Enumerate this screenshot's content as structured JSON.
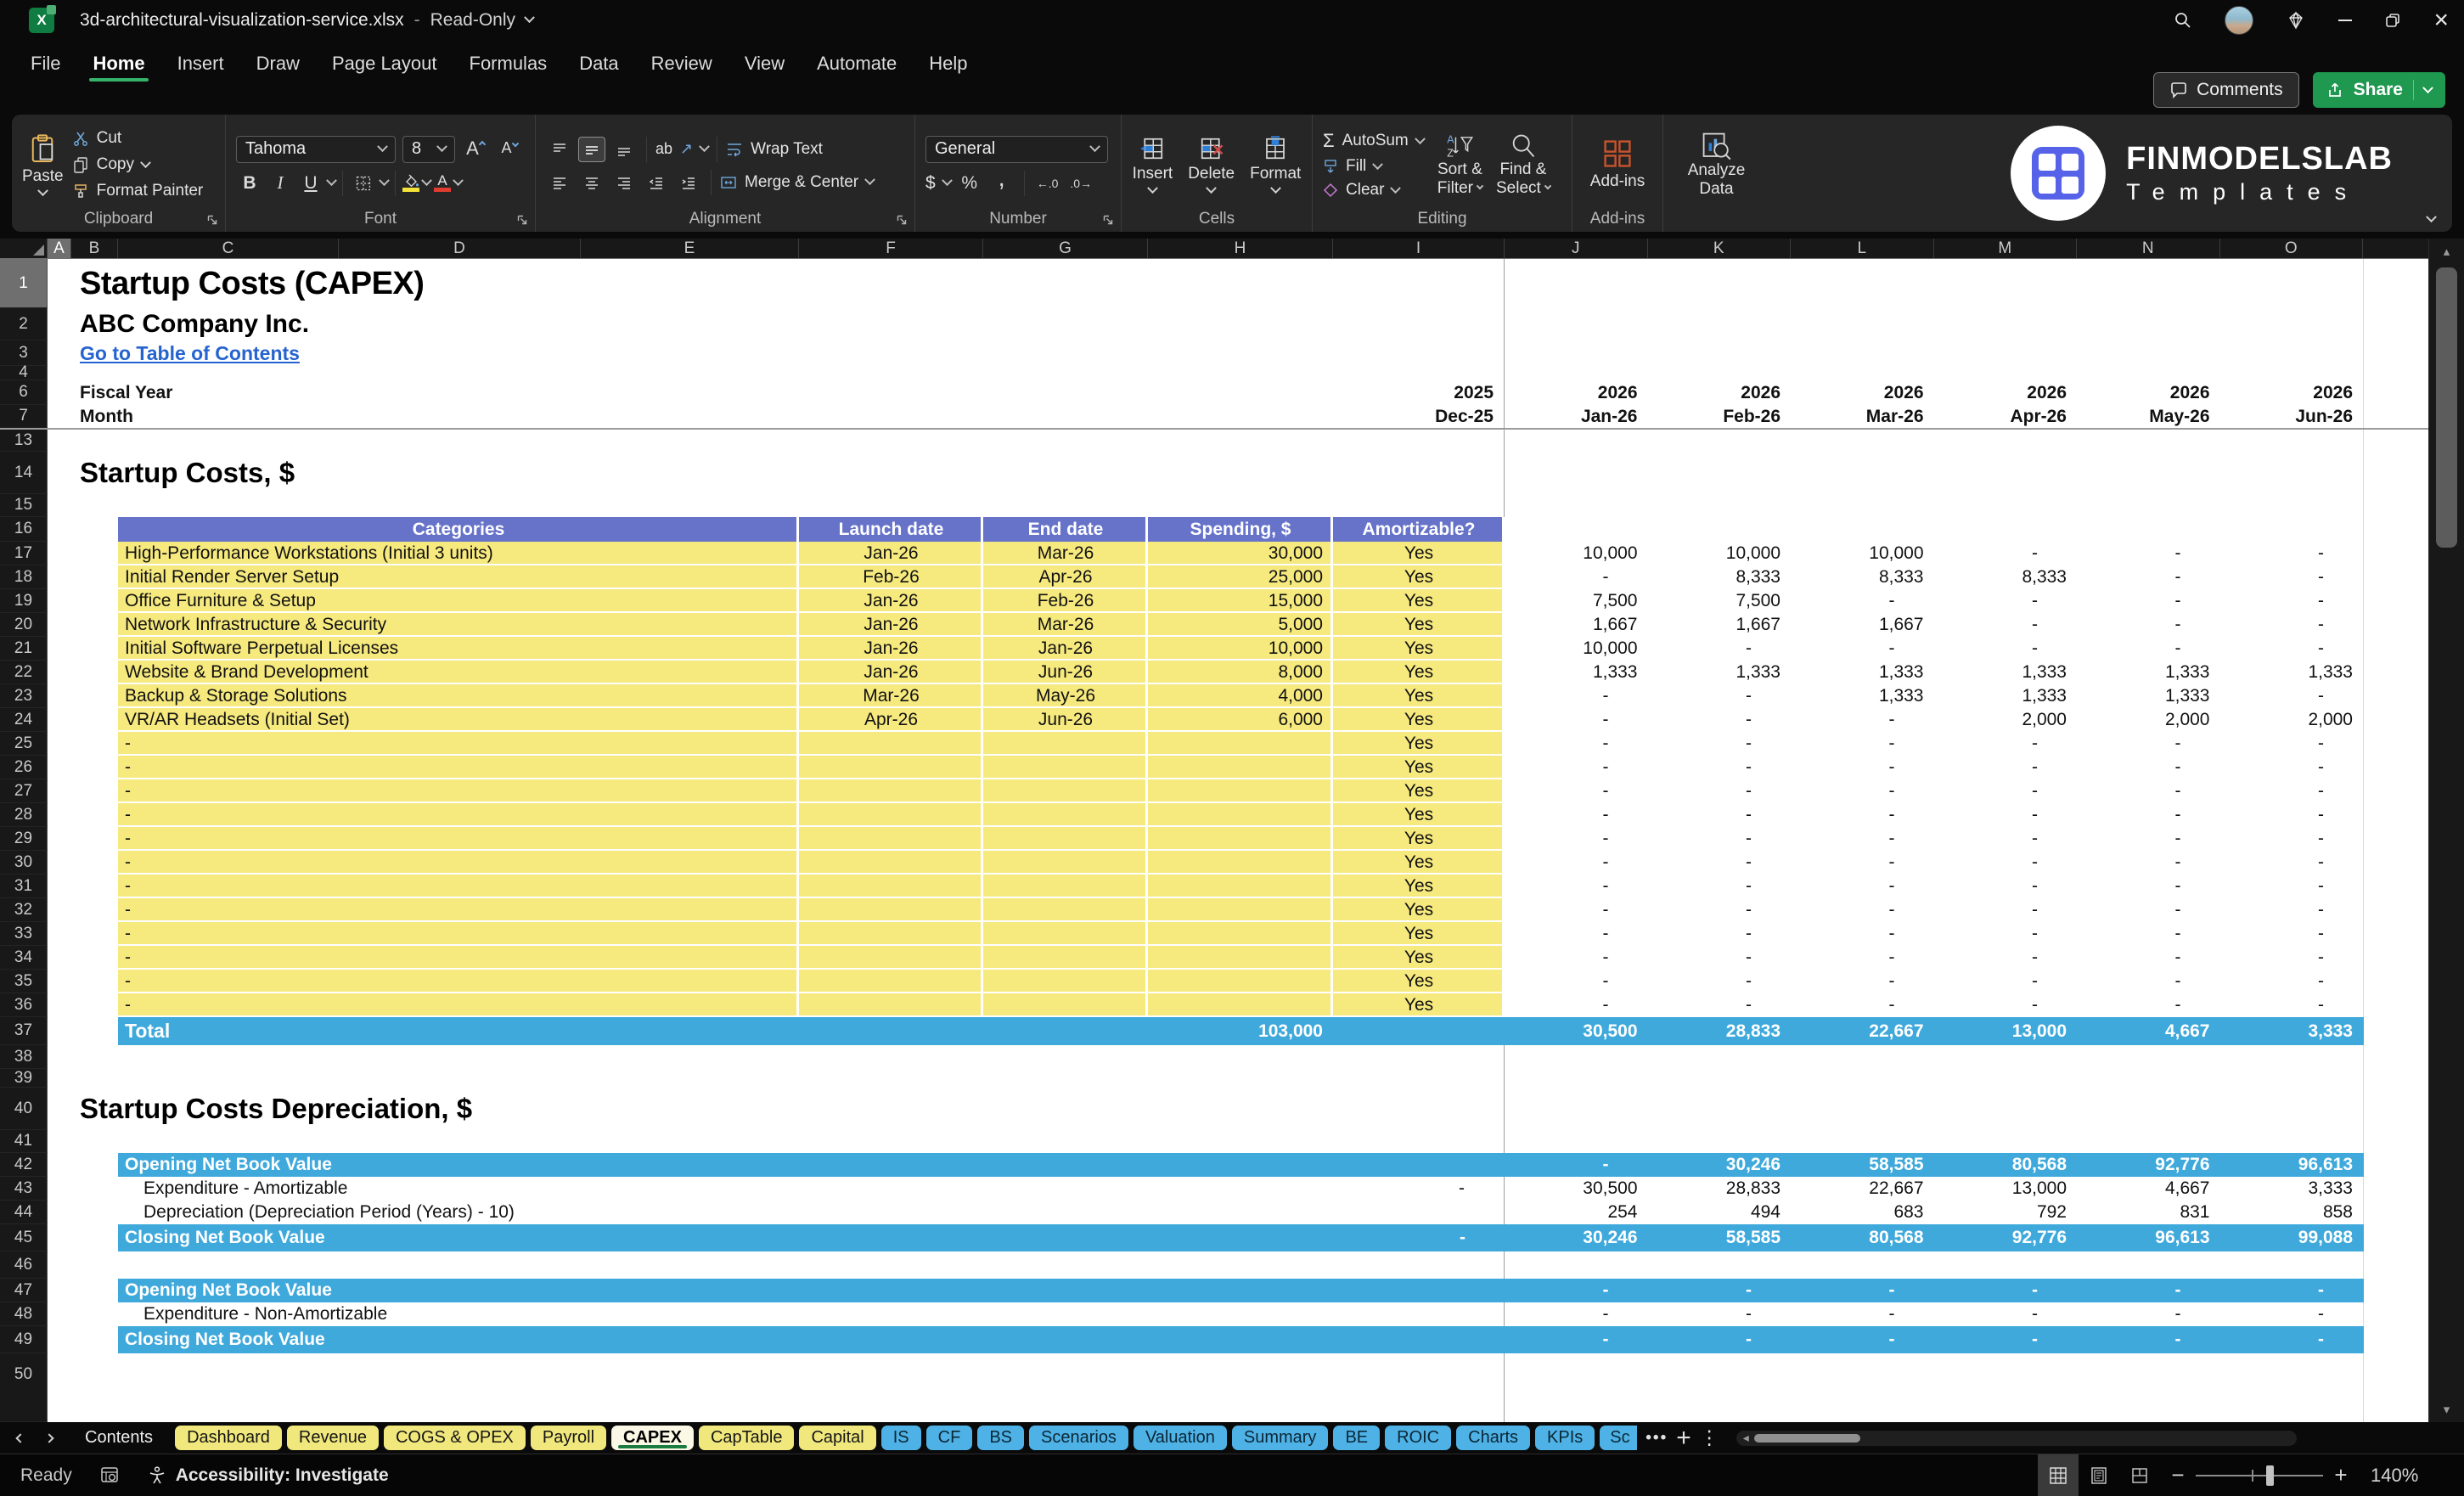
{
  "titlebar": {
    "filename": "3d-architectural-visualization-service.xlsx",
    "separator": "-",
    "mode": "Read-Only"
  },
  "menu": {
    "tabs": [
      {
        "label": "File",
        "cls": ""
      },
      {
        "label": "Home",
        "cls": "active"
      },
      {
        "label": "Insert",
        "cls": ""
      },
      {
        "label": "Draw",
        "cls": ""
      },
      {
        "label": "Page Layout",
        "cls": ""
      },
      {
        "label": "Formulas",
        "cls": ""
      },
      {
        "label": "Data",
        "cls": ""
      },
      {
        "label": "Review",
        "cls": ""
      },
      {
        "label": "View",
        "cls": ""
      },
      {
        "label": "Automate",
        "cls": ""
      },
      {
        "label": "Help",
        "cls": ""
      }
    ],
    "comments_label": "Comments",
    "share_label": "Share"
  },
  "ribbon": {
    "clipboard": {
      "label": "Clipboard",
      "paste": "Paste",
      "cut": "Cut",
      "copy": "Copy",
      "format_painter": "Format Painter"
    },
    "font": {
      "label": "Font",
      "font_name": "Tahoma",
      "font_size": "8",
      "grow": "A",
      "shrink": "A",
      "bold": "B",
      "italic": "I",
      "underline": "U"
    },
    "alignment": {
      "label": "Alignment",
      "orientation": "ab",
      "wrap_text": "Wrap Text",
      "merge_center": "Merge & Center"
    },
    "number": {
      "label": "Number",
      "format": "General",
      "currency": "$",
      "percent": "%",
      "comma": ",",
      "inc_decimal": "←.0",
      "dec_decimal": ".0→"
    },
    "cells": {
      "label": "Cells",
      "insert": "Insert",
      "delete": "Delete",
      "format": "Format"
    },
    "editing": {
      "label": "Editing",
      "sigma": "Σ",
      "autosum": "AutoSum",
      "fill": "Fill",
      "clear": "Clear",
      "sort1": "Sort &",
      "sort2": "Filter",
      "find1": "Find &",
      "find2": "Select"
    },
    "addins": {
      "label": "Add-ins",
      "addins": "Add-ins",
      "analyze1": "Analyze",
      "analyze2": "Data"
    },
    "logo": {
      "title": "FINMODELSLAB",
      "subtitle": "Templates"
    },
    "accent_green": "#35b36b"
  },
  "sheet": {
    "columns": [
      {
        "letter": "A",
        "cls": "wa sel"
      },
      {
        "letter": "B",
        "cls": "wb"
      },
      {
        "letter": "C",
        "cls": "wc"
      },
      {
        "letter": "D",
        "cls": "wd"
      },
      {
        "letter": "E",
        "cls": "we"
      },
      {
        "letter": "F",
        "cls": "wf"
      },
      {
        "letter": "G",
        "cls": "wg"
      },
      {
        "letter": "H",
        "cls": "wh"
      },
      {
        "letter": "I",
        "cls": "wi"
      },
      {
        "letter": "J",
        "cls": "wm"
      },
      {
        "letter": "K",
        "cls": "wm"
      },
      {
        "letter": "L",
        "cls": "wm"
      },
      {
        "letter": "M",
        "cls": "wm"
      },
      {
        "letter": "N",
        "cls": "wm"
      },
      {
        "letter": "O",
        "cls": "wm"
      }
    ],
    "rn": {
      "r1": "1",
      "r2": "2",
      "r3": "3",
      "r4": "4",
      "r6": "6",
      "r7": "7",
      "r13": "13",
      "r14": "14",
      "r15": "15",
      "r16": "16",
      "r37": "37",
      "r38": "38",
      "r39": "39",
      "r40": "40",
      "r41": "41",
      "r46": "46",
      "r50": "50"
    },
    "title": "Startup Costs (CAPEX)",
    "company": "ABC Company Inc.",
    "toc_link": "Go to Table of Contents",
    "fiscal_year_label": "Fi­scal Year",
    "month_label": "Month",
    "fiscal_years": [
      "2025",
      "2026",
      "2026",
      "2026",
      "2026",
      "2026",
      "2026"
    ],
    "months": [
      "Dec-25",
      "Jan-26",
      "Feb-26",
      "Mar-26",
      "Apr-26",
      "May-26",
      "Jun-26"
    ],
    "section1_title": "Startup Costs, $",
    "section2_title": "Startup Costs Depreciation, $",
    "table": {
      "headers": [
        "Categories",
        "Launch date",
        "End date",
        "Spending, $",
        "Amortizable?"
      ],
      "rows": [
        {
          "n": "17",
          "category": "High-Performance Workstations (Initial 3 units)",
          "launch": "Jan-26",
          "end": "Mar-26",
          "spending": "30,000",
          "amort": "Yes",
          "m": [
            "10,000",
            "10,000",
            "10,000",
            "-",
            "-",
            "-"
          ]
        },
        {
          "n": "18",
          "category": "Initial Render Server Setup",
          "launch": "Feb-26",
          "end": "Apr-26",
          "spending": "25,000",
          "amort": "Yes",
          "m": [
            "-",
            "8,333",
            "8,333",
            "8,333",
            "-",
            "-"
          ]
        },
        {
          "n": "19",
          "category": "Office Furniture & Setup",
          "launch": "Jan-26",
          "end": "Feb-26",
          "spending": "15,000",
          "amort": "Yes",
          "m": [
            "7,500",
            "7,500",
            "-",
            "-",
            "-",
            "-"
          ]
        },
        {
          "n": "20",
          "category": "Network Infrastructure & Security",
          "launch": "Jan-26",
          "end": "Mar-26",
          "spending": "5,000",
          "amort": "Yes",
          "m": [
            "1,667",
            "1,667",
            "1,667",
            "-",
            "-",
            "-"
          ]
        },
        {
          "n": "21",
          "category": "Initial Software Perpetual Licenses",
          "launch": "Jan-26",
          "end": "Jan-26",
          "spending": "10,000",
          "amort": "Yes",
          "m": [
            "10,000",
            "-",
            "-",
            "-",
            "-",
            "-"
          ]
        },
        {
          "n": "22",
          "category": "Website & Brand Development",
          "launch": "Jan-26",
          "end": "Jun-26",
          "spending": "8,000",
          "amort": "Yes",
          "m": [
            "1,333",
            "1,333",
            "1,333",
            "1,333",
            "1,333",
            "1,333"
          ]
        },
        {
          "n": "23",
          "category": "Backup & Storage Solutions",
          "launch": "Mar-26",
          "end": "May-26",
          "spending": "4,000",
          "amort": "Yes",
          "m": [
            "-",
            "-",
            "1,333",
            "1,333",
            "1,333",
            "-"
          ]
        },
        {
          "n": "24",
          "category": "VR/AR Headsets (Initial Set)",
          "launch": "Apr-26",
          "end": "Jun-26",
          "spending": "6,000",
          "amort": "Yes",
          "m": [
            "-",
            "-",
            "-",
            "2,000",
            "2,000",
            "2,000"
          ]
        },
        {
          "n": "25",
          "category": "-",
          "launch": "",
          "end": "",
          "spending": "",
          "amort": "Yes",
          "m": [
            "-",
            "-",
            "-",
            "-",
            "-",
            "-"
          ]
        },
        {
          "n": "26",
          "category": "-",
          "launch": "",
          "end": "",
          "spending": "",
          "amort": "Yes",
          "m": [
            "-",
            "-",
            "-",
            "-",
            "-",
            "-"
          ]
        },
        {
          "n": "27",
          "category": "-",
          "launch": "",
          "end": "",
          "spending": "",
          "amort": "Yes",
          "m": [
            "-",
            "-",
            "-",
            "-",
            "-",
            "-"
          ]
        },
        {
          "n": "28",
          "category": "-",
          "launch": "",
          "end": "",
          "spending": "",
          "amort": "Yes",
          "m": [
            "-",
            "-",
            "-",
            "-",
            "-",
            "-"
          ]
        },
        {
          "n": "29",
          "category": "-",
          "launch": "",
          "end": "",
          "spending": "",
          "amort": "Yes",
          "m": [
            "-",
            "-",
            "-",
            "-",
            "-",
            "-"
          ]
        },
        {
          "n": "30",
          "category": "-",
          "launch": "",
          "end": "",
          "spending": "",
          "amort": "Yes",
          "m": [
            "-",
            "-",
            "-",
            "-",
            "-",
            "-"
          ]
        },
        {
          "n": "31",
          "category": "-",
          "launch": "",
          "end": "",
          "spending": "",
          "amort": "Yes",
          "m": [
            "-",
            "-",
            "-",
            "-",
            "-",
            "-"
          ]
        },
        {
          "n": "32",
          "category": "-",
          "launch": "",
          "end": "",
          "spending": "",
          "amort": "Yes",
          "m": [
            "-",
            "-",
            "-",
            "-",
            "-",
            "-"
          ]
        },
        {
          "n": "33",
          "category": "-",
          "launch": "",
          "end": "",
          "spending": "",
          "amort": "Yes",
          "m": [
            "-",
            "-",
            "-",
            "-",
            "-",
            "-"
          ]
        },
        {
          "n": "34",
          "category": "-",
          "launch": "",
          "end": "",
          "spending": "",
          "amort": "Yes",
          "m": [
            "-",
            "-",
            "-",
            "-",
            "-",
            "-"
          ]
        },
        {
          "n": "35",
          "category": "-",
          "launch": "",
          "end": "",
          "spending": "",
          "amort": "Yes",
          "m": [
            "-",
            "-",
            "-",
            "-",
            "-",
            "-"
          ]
        },
        {
          "n": "36",
          "category": "-",
          "launch": "",
          "end": "",
          "spending": "",
          "amort": "Yes",
          "m": [
            "-",
            "-",
            "-",
            "-",
            "-",
            "-"
          ]
        }
      ],
      "total": {
        "label": "Total",
        "spending": "103,000",
        "m": [
          "30,500",
          "28,833",
          "22,667",
          "13,000",
          "4,667",
          "3,333"
        ]
      }
    },
    "dep1": [
      {
        "n": "42",
        "style": "blue",
        "label": "Opening Net Book Value",
        "i": "",
        "m": [
          "-",
          "30,246",
          "58,585",
          "80,568",
          "92,776",
          "96,613"
        ]
      },
      {
        "n": "43",
        "style": "white",
        "label": "Expenditure - Amortizable",
        "i": "-",
        "m": [
          "30,500",
          "28,833",
          "22,667",
          "13,000",
          "4,667",
          "3,333"
        ]
      },
      {
        "n": "44",
        "style": "white",
        "label": "Depreciation (Depreciation Period (Years) - 10)",
        "i": "",
        "m": [
          "254",
          "494",
          "683",
          "792",
          "831",
          "858"
        ]
      },
      {
        "n": "45",
        "style": "blue tall",
        "label": "Closing Net Book Value",
        "i": "-",
        "m": [
          "30,246",
          "58,585",
          "80,568",
          "92,776",
          "96,613",
          "99,088"
        ]
      }
    ],
    "dep2": [
      {
        "n": "47",
        "style": "blue",
        "label": "Opening Net Book Value",
        "i": "",
        "m": [
          "-",
          "-",
          "-",
          "-",
          "-",
          "-"
        ]
      },
      {
        "n": "48",
        "style": "white",
        "label": "Expenditure - Non-Amortizable",
        "i": "",
        "m": [
          "-",
          "-",
          "-",
          "-",
          "-",
          "-"
        ]
      },
      {
        "n": "49",
        "style": "blue tall",
        "label": "Closing Net Book Value",
        "i": "",
        "m": [
          "-",
          "-",
          "-",
          "-",
          "-",
          "-"
        ]
      }
    ],
    "colors": {
      "table_header": "#6673C9",
      "table_body": "#F6E97E",
      "total_band": "#3FA9DC",
      "link": "#2563cf"
    }
  },
  "tabs": {
    "items": [
      {
        "label": "Contents",
        "style": "plain"
      },
      {
        "label": "Dashboard",
        "style": "yellow"
      },
      {
        "label": "Revenue",
        "style": "yellow"
      },
      {
        "label": "COGS & OPEX",
        "style": "yellow"
      },
      {
        "label": "Payroll",
        "style": "yellow"
      },
      {
        "label": "CAPEX",
        "style": "active"
      },
      {
        "label": "CapTable",
        "style": "yellow"
      },
      {
        "label": "Capital",
        "style": "yellow"
      },
      {
        "label": "IS",
        "style": "blue"
      },
      {
        "label": "CF",
        "style": "blue"
      },
      {
        "label": "BS",
        "style": "blue"
      },
      {
        "label": "Scenarios",
        "style": "blue"
      },
      {
        "label": "Valuation",
        "style": "blue"
      },
      {
        "label": "Summary",
        "style": "blue"
      },
      {
        "label": "BE",
        "style": "blue"
      },
      {
        "label": "ROIC",
        "style": "blue"
      },
      {
        "label": "Charts",
        "style": "blue"
      },
      {
        "label": "KPIs",
        "style": "blue"
      },
      {
        "label": "Sc",
        "style": "blue cut"
      }
    ],
    "more": "•••",
    "add": "+",
    "kebab": "⋮"
  },
  "statusbar": {
    "ready": "Ready",
    "accessibility": "Accessibility: Investigate",
    "zoom": "140%",
    "minus": "−",
    "plus": "+"
  }
}
